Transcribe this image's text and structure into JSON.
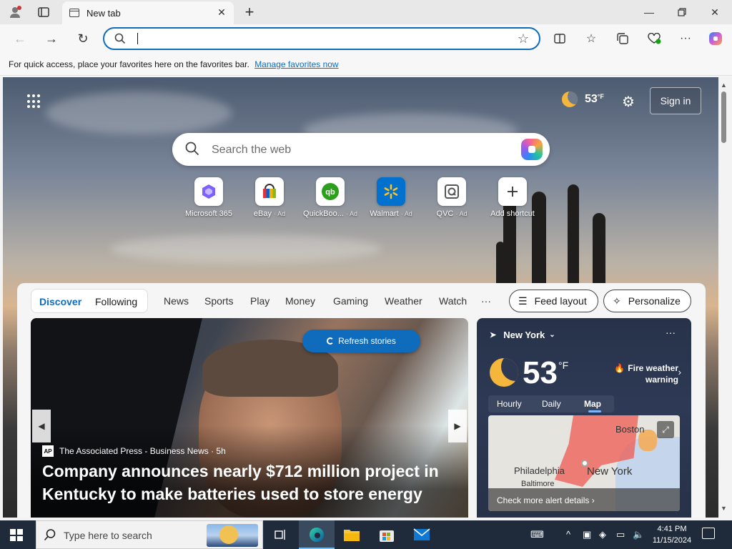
{
  "browser": {
    "tab_title": "New tab",
    "favorites_prompt": "For quick access, place your favorites here on the favorites bar.",
    "favorites_link": "Manage favorites now"
  },
  "ntp": {
    "weather_temp": "53",
    "weather_unit": "°F",
    "sign_in": "Sign in",
    "search_placeholder": "Search the web",
    "shortcuts": [
      {
        "label": "Microsoft 365",
        "ad": ""
      },
      {
        "label": "eBay",
        "ad": "· Ad"
      },
      {
        "label": "QuickBoo...",
        "ad": "· Ad"
      },
      {
        "label": "Walmart",
        "ad": "· Ad"
      },
      {
        "label": "QVC",
        "ad": "· Ad"
      },
      {
        "label": "Add shortcut",
        "ad": ""
      }
    ]
  },
  "feed": {
    "tab_discover": "Discover",
    "tab_following": "Following",
    "nav": [
      "News",
      "Sports",
      "Play",
      "Money",
      "Gaming",
      "Weather",
      "Watch",
      "···"
    ],
    "feed_layout": "Feed layout",
    "personalize": "Personalize",
    "refresh": "Refresh stories",
    "hero_source": "The Associated Press - Business News · 5h",
    "hero_source_logo": "AP",
    "hero_headline": "Company announces nearly $712 million project in Kentucky to make batteries used to store energy"
  },
  "weather_card": {
    "location": "New York",
    "more": "···",
    "temp": "53",
    "unit": "°F",
    "alert": "Fire weather warning",
    "tabs": [
      "Hourly",
      "Daily",
      "Map"
    ],
    "cities": {
      "boston": "Boston",
      "philadelphia": "Philadelphia",
      "new_york": "New York",
      "baltimore": "Baltimore"
    },
    "check_alerts": "Check more alert details ›"
  },
  "taskbar": {
    "search_placeholder": "Type here to search",
    "time": "4:41 PM",
    "date": "11/15/2024"
  },
  "colors": {
    "accent": "#0f6cbd",
    "taskbar": "#1f2b3b",
    "alert_red": "#e8392b"
  }
}
